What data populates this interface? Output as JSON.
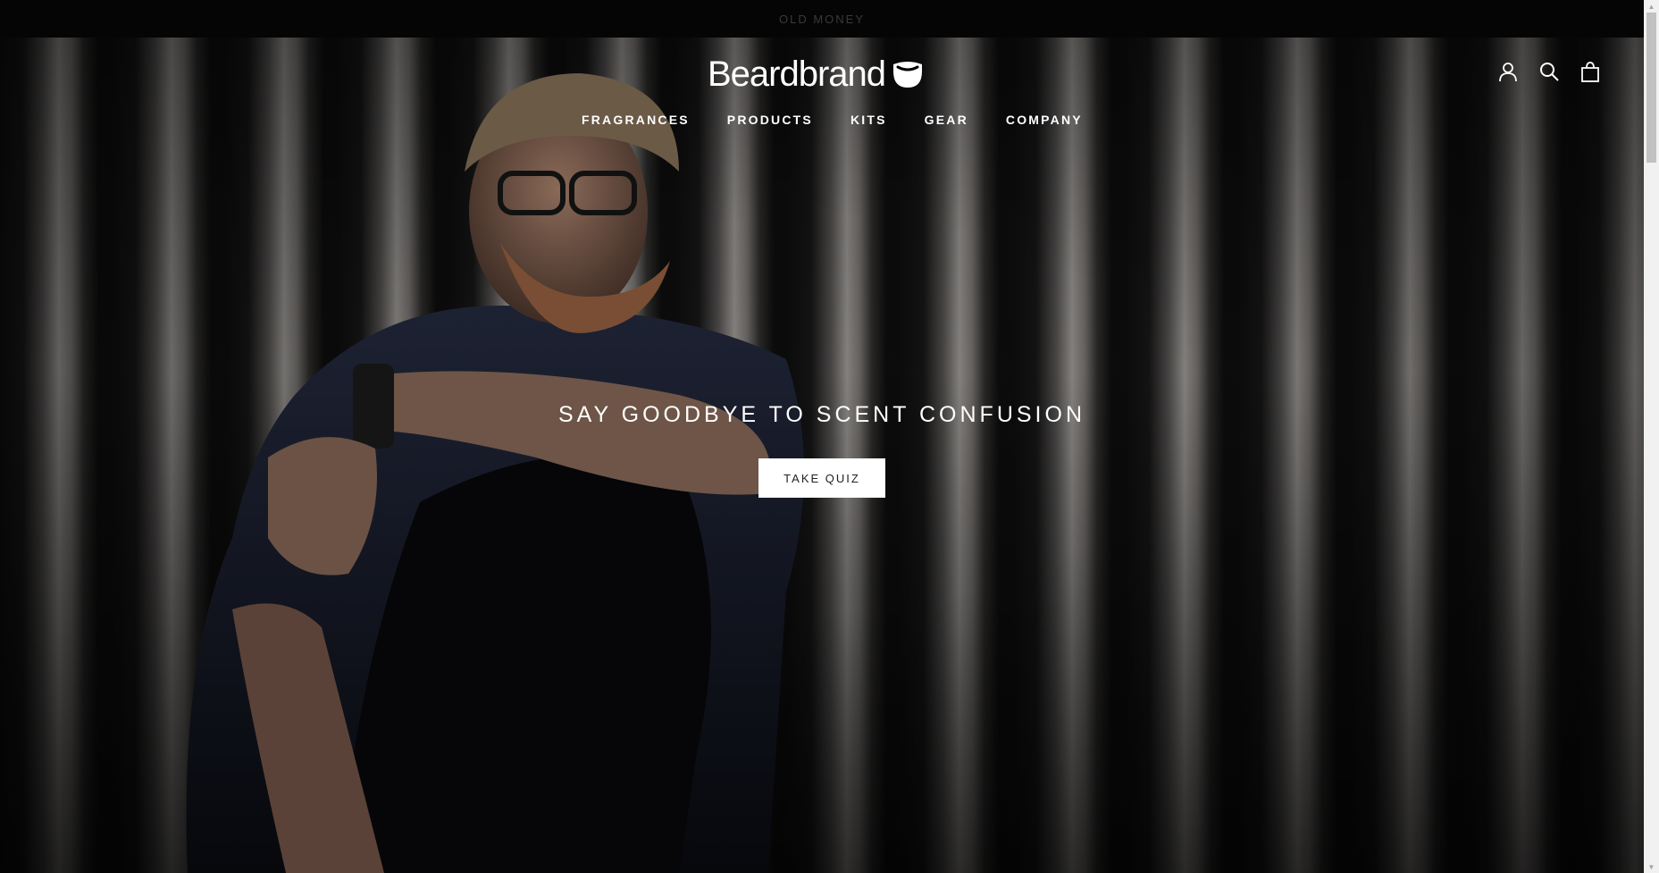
{
  "announcement": {
    "text": "OLD MONEY"
  },
  "header": {
    "logo_text": "Beardbrand",
    "nav": [
      "FRAGRANCES",
      "PRODUCTS",
      "KITS",
      "GEAR",
      "COMPANY"
    ],
    "icons": [
      "account-icon",
      "search-icon",
      "cart-icon"
    ]
  },
  "hero": {
    "title": "SAY GOODBYE TO SCENT CONFUSION",
    "button_label": "TAKE QUIZ"
  },
  "colors": {
    "announcement_bg": "#050505",
    "button_bg": "#ffffff",
    "text_light": "#ffffff"
  }
}
